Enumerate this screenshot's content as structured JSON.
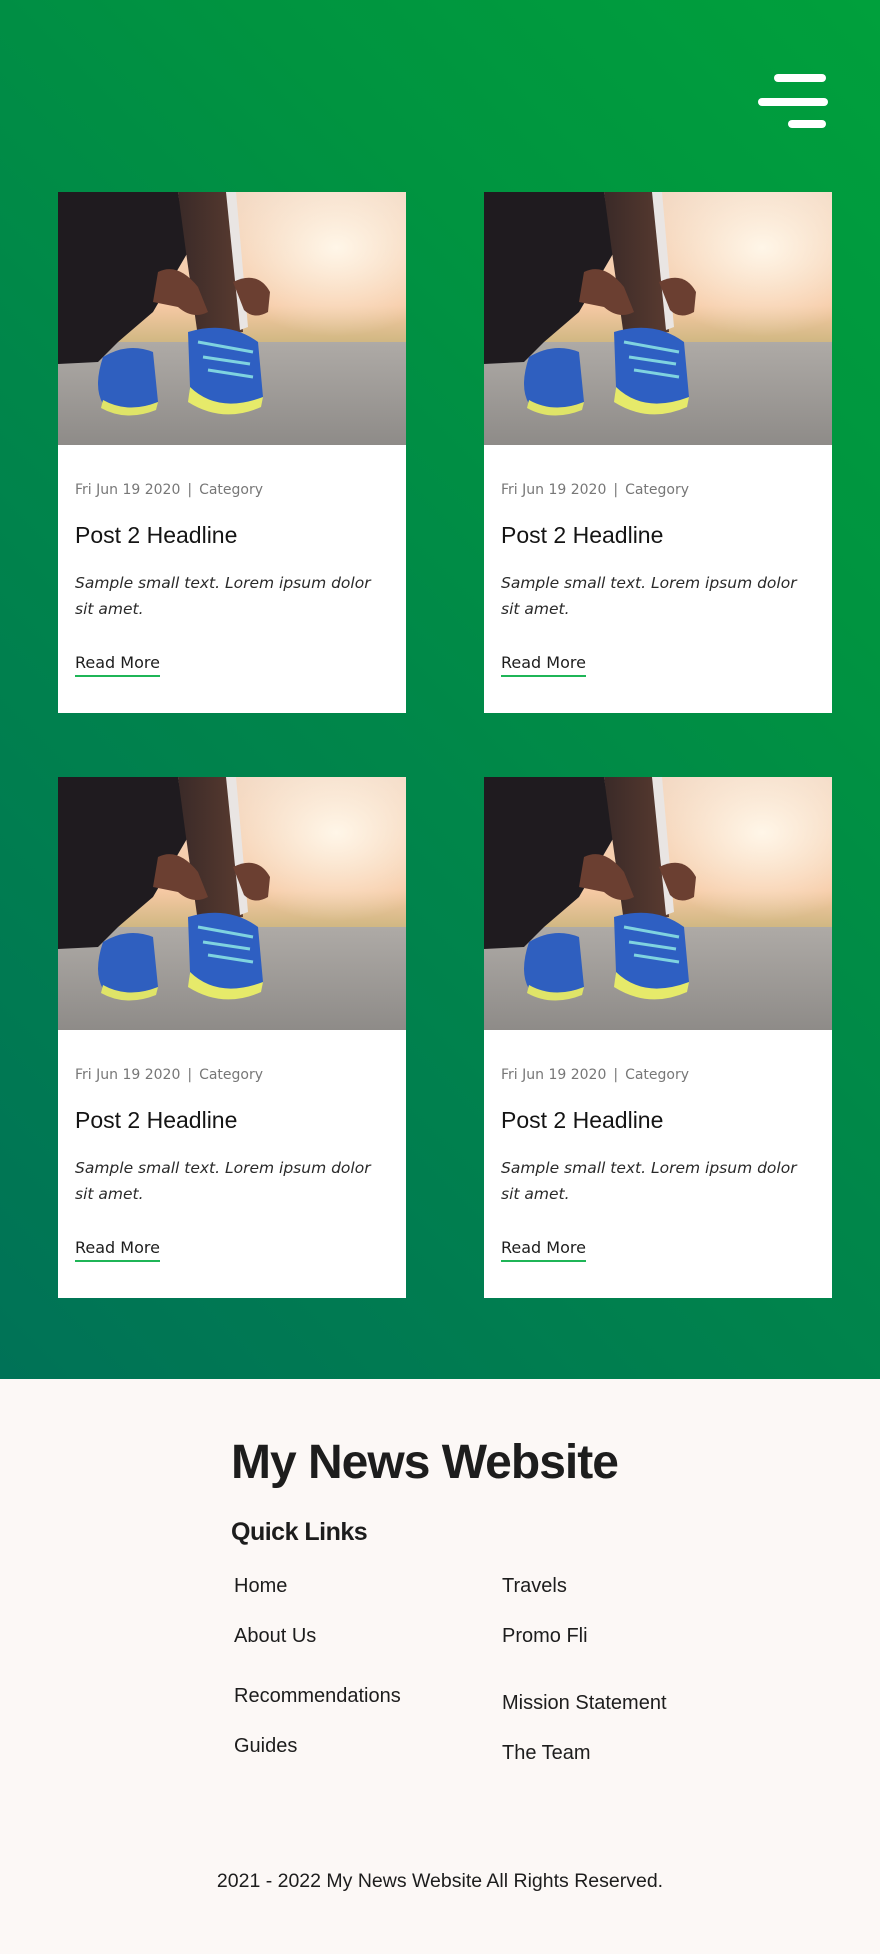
{
  "header": {
    "menu_icon": "hamburger-menu-icon"
  },
  "posts": [
    {
      "image": "runner-tying-shoelace-photo",
      "date": "Fri Jun 19 2020",
      "separator": "|",
      "category": "Category",
      "headline": "Post 2 Headline",
      "excerpt": "Sample small text. Lorem ipsum dolor sit amet.",
      "link": "Read More"
    },
    {
      "image": "runner-tying-shoelace-photo",
      "date": "Fri Jun 19 2020",
      "separator": "|",
      "category": "Category",
      "headline": "Post 2 Headline",
      "excerpt": "Sample small text. Lorem ipsum dolor sit amet.",
      "link": "Read More"
    },
    {
      "image": "runner-tying-shoelace-photo",
      "date": "Fri Jun 19 2020",
      "separator": "|",
      "category": "Category",
      "headline": "Post 2 Headline",
      "excerpt": "Sample small text. Lorem ipsum dolor sit amet.",
      "link": "Read More"
    },
    {
      "image": "runner-tying-shoelace-photo",
      "date": "Fri Jun 19 2020",
      "separator": "|",
      "category": "Category",
      "headline": "Post 2 Headline",
      "excerpt": "Sample small text. Lorem ipsum dolor sit amet.",
      "link": "Read More"
    }
  ],
  "footer": {
    "site_title": "My News Website",
    "quick_links_title": "Quick Links",
    "links": [
      "Home",
      "About Us",
      "Recommendations",
      "Guides",
      "Travels",
      "Promo Fli",
      "Mission Statement",
      "The Team"
    ],
    "copyright": "2021 - 2022 My News Website All Rights Reserved."
  },
  "colors": {
    "hero_gradient_start": "#00a03c",
    "hero_gradient_end": "#007257",
    "link_underline": "#1fb557",
    "footer_background": "#fcf8f6"
  }
}
